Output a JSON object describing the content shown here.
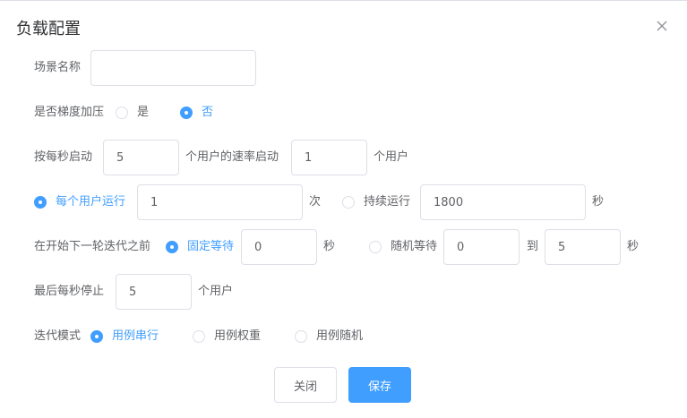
{
  "dialog": {
    "title": "负载配置",
    "close_icon": "close-icon"
  },
  "form": {
    "scene_name": {
      "label": "场景名称",
      "value": ""
    },
    "gradient": {
      "label": "是否梯度加压",
      "options": [
        {
          "label": "是",
          "selected": false
        },
        {
          "label": "否",
          "selected": true
        }
      ]
    },
    "startup": {
      "prefix": "按每秒启动",
      "rate_value": "5",
      "middle": "个用户的速率启动",
      "users_value": "1",
      "suffix": "个用户"
    },
    "run_mode": {
      "per_user": {
        "label": "每个用户运行",
        "selected": true,
        "value": "1",
        "unit": "次"
      },
      "duration": {
        "label": "持续运行",
        "selected": false,
        "value": "1800",
        "unit": "秒"
      }
    },
    "iteration_wait": {
      "label": "在开始下一轮迭代之前",
      "fixed": {
        "label": "固定等待",
        "selected": true,
        "value": "0",
        "unit": "秒"
      },
      "random": {
        "label": "随机等待",
        "selected": false,
        "from": "0",
        "to_label": "到",
        "to": "5",
        "unit": "秒"
      }
    },
    "stop": {
      "prefix": "最后每秒停止",
      "value": "5",
      "suffix": "个用户"
    },
    "iteration_mode": {
      "label": "迭代模式",
      "options": [
        {
          "label": "用例串行",
          "selected": true
        },
        {
          "label": "用例权重",
          "selected": false
        },
        {
          "label": "用例随机",
          "selected": false
        }
      ]
    }
  },
  "footer": {
    "close_label": "关闭",
    "save_label": "保存"
  },
  "colors": {
    "accent": "#409eff",
    "text": "#606266",
    "border": "#dcdfe6"
  }
}
